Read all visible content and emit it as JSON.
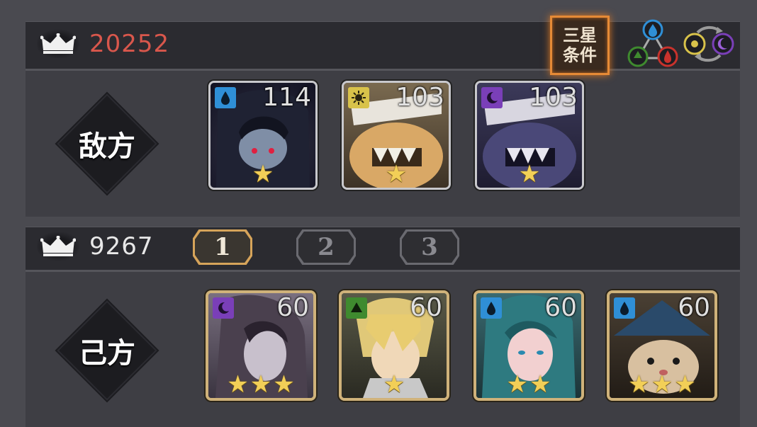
{
  "enemy": {
    "power": "20252",
    "side_label": "敌方",
    "units": [
      {
        "level": "114",
        "element": "water-icon",
        "stars": 1,
        "art": "dark-haired-girl-portrait"
      },
      {
        "level": "103",
        "element": "sun-icon",
        "stars": 1,
        "art": "bandaged-monster-portrait"
      },
      {
        "level": "103",
        "element": "moon-icon",
        "stars": 1,
        "art": "bandaged-monster-dark-portrait"
      }
    ]
  },
  "three_star_condition": {
    "line1": "三星",
    "line2": "条件"
  },
  "ally": {
    "power": "9267",
    "side_label": "己方",
    "teams": [
      "1",
      "2",
      "3"
    ],
    "selected_team": "1",
    "units": [
      {
        "level": "60",
        "element": "moon-icon",
        "stars": 3,
        "art": "long-haired-woman-portrait"
      },
      {
        "level": "60",
        "element": "leaf-icon",
        "stars": 1,
        "art": "blond-boy-portrait"
      },
      {
        "level": "60",
        "element": "water-icon",
        "stars": 2,
        "art": "teal-haired-woman-portrait"
      },
      {
        "level": "60",
        "element": "water-icon",
        "stars": 3,
        "art": "hamster-witch-portrait"
      }
    ]
  },
  "colors": {
    "water": "#2f8fd6",
    "sun": "#d8c24a",
    "moon": "#7a3fb8",
    "leaf": "#3f8a2f",
    "fire": "#c8322c",
    "enemy_power": "#d9574c",
    "selected_tab": "#d6a45a"
  }
}
